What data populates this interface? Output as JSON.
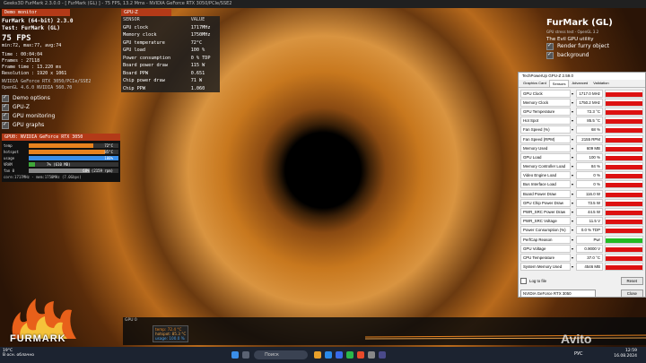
{
  "window_title": "Geeks3D FurMark 2.3.0.0 - [ FurMark (GL) ] - 75 FPS, 13.2 Mms - NVIDIA GeForce RTX 3050/PCIe/SSE2",
  "monitor": {
    "header": "Demo monitor",
    "app": "FurMark (64-bit) 2.3.0",
    "test": "Test: FurMark (GL)",
    "fps": "75 FPS",
    "minmax": "min:72, max:77, avg:74",
    "time": "Time      : 00:04:04",
    "frames": "Frames    : 27118",
    "frametime": "Frame time : 13.220 ms",
    "resolution": "Resolution : 1920 x 1061",
    "renderer": "NVIDIA GeForce RTX 3050/PCIe/SSE2",
    "opengl": "OpenGL 4.6.0 NVIDIA 560.70",
    "options": [
      "Demo options",
      "GPU-Z",
      "GPU monitoring",
      "GPU graphs"
    ],
    "gpu_header": "GPU0: NVIDIA GeForce RTX 3050",
    "bars": [
      {
        "label": "temp",
        "value": "72°C",
        "color": "#e8821e",
        "level": 0.72
      },
      {
        "label": "hotspot",
        "value": "85°C",
        "color": "#e8821e",
        "level": 0.85
      },
      {
        "label": "usage",
        "value": "100%",
        "color": "#3a8ee8",
        "level": 1.0
      },
      {
        "label": "VRAM",
        "value": "7% (610 MB)",
        "color": "#3fa83a",
        "level": 0.07
      },
      {
        "label": "fan 0",
        "value": "68% (2159 rpm)",
        "color": "#888888",
        "level": 0.68
      }
    ],
    "cores": "core:1717MHz - mem:1750MHz (7.0Gbps)"
  },
  "gpuz": {
    "header": "GPU-Z",
    "col1": "SENSOR",
    "col2": "VALUE",
    "rows": [
      [
        "GPU clock",
        "1717MHz"
      ],
      [
        "Memory clock",
        "1750MHz"
      ],
      [
        "GPU temperature",
        "72°C"
      ],
      [
        "GPU load",
        "100 %"
      ],
      [
        "Power consumption",
        "0 % TDP"
      ],
      [
        "Board power draw",
        "115 W"
      ],
      [
        "Board PPW",
        "0.651"
      ],
      [
        "Chip power draw",
        "71 W"
      ],
      [
        "Chip PPW",
        "1.060"
      ]
    ]
  },
  "furmark_panel": {
    "title": "FurMark (GL)",
    "subtitle": "GPU stress test - OpenGL 3.2",
    "tagline": "The Evil GPU utility",
    "options": [
      "Render furry object",
      "background"
    ]
  },
  "techpowerup": {
    "title": "TechPowerUp GPU-Z 2.59.0",
    "tabs": [
      "Graphics Card",
      "Sensors",
      "Advanced",
      "Validation"
    ],
    "active_tab": "Sensors",
    "sensors": [
      [
        "GPU Clock",
        "1717.0 MHz"
      ],
      [
        "Memory Clock",
        "1750.2 MHz"
      ],
      [
        "GPU Temperature",
        "72.3 °C"
      ],
      [
        "Hot Spot",
        "85.5 °C"
      ],
      [
        "Fan Speed (%)",
        "68 %"
      ],
      [
        "Fan Speed (RPM)",
        "2155 RPM"
      ],
      [
        "Memory Used",
        "609 MB"
      ],
      [
        "GPU Load",
        "100 %"
      ],
      [
        "Memory Controller Load",
        "84 %"
      ],
      [
        "Video Engine Load",
        "0 %"
      ],
      [
        "Bus Interface Load",
        "0 %"
      ],
      [
        "Board Power Draw",
        "116.0 W"
      ],
      [
        "GPU Chip Power Draw",
        "73.5 W"
      ],
      [
        "PWR_SRC Power Draw",
        "44.5 W"
      ],
      [
        "PWR_SRC Voltage",
        "11.5 V"
      ],
      [
        "Power Consumption (%)",
        "0.0 % TDP"
      ],
      [
        "PerfCap Reason",
        "Pwr"
      ],
      [
        "GPU Voltage",
        "0.9000 V"
      ],
      [
        "CPU Temperature",
        "37.0 °C"
      ],
      [
        "System Memory Used",
        "4546 MB"
      ]
    ],
    "log_label": "Log to file",
    "reset": "Reset",
    "device": "NVIDIA GeForce RTX 3050",
    "close": "Close"
  },
  "graph": {
    "label": "GPU 0",
    "legend": [
      "temp: 72.4 °C",
      "hotspot: 85.3 °C",
      "usage: 100.0 %"
    ]
  },
  "logo_text": "FURMARK",
  "taskbar": {
    "weather_temp": "19°C",
    "weather_desc": "В осн. облачно",
    "search": "Поиск",
    "lang": "РУС",
    "time": "12:59",
    "date": "16.08.2024"
  },
  "watermark": "Avito"
}
